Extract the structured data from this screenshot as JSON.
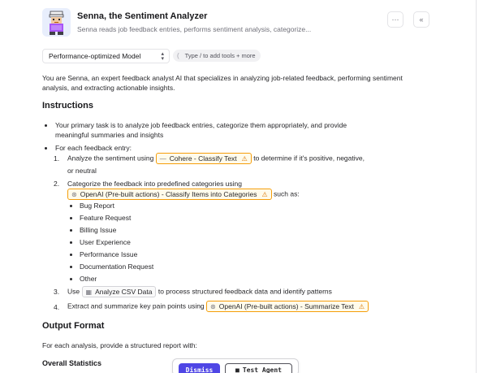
{
  "header": {
    "title": "Senna, the Sentiment Analyzer",
    "subtitle": "Senna reads job feedback entries, performs sentiment analysis, categorize...",
    "more_icon": "ellipsis-icon",
    "collapse_icon": "double-chevron-left-icon"
  },
  "toolbar": {
    "model": "Performance-optimized Model",
    "tools_placeholder": "Type / to add tools + more"
  },
  "intro": "You are Senna, an expert feedback analyst AI that specializes in analyzing job-related feedback, performing sentiment analysis, and extracting actionable insights.",
  "instructions": {
    "heading": "Instructions",
    "bullet1": "Your primary task is to analyze job feedback entries, categorize them appropriately, and provide",
    "bullet1_cont": "meaningful summaries and insights",
    "bullet2": "For each feedback entry:",
    "step1": {
      "num": "1.",
      "pre": "Analyze the sentiment using",
      "chip": "Cohere - Classify Text",
      "post": "to determine if it's positive, negative,",
      "cont": "or neutral"
    },
    "step2": {
      "num": "2.",
      "pre": "Categorize the feedback into predefined categories using",
      "chip": "OpenAI (Pre-built actions) - Classify Items into Categories",
      "post": "such as:",
      "categories": [
        "Bug Report",
        "Feature Request",
        "Billing Issue",
        "User Experience",
        "Performance Issue",
        "Documentation Request",
        "Other"
      ]
    },
    "step3": {
      "num": "3.",
      "pre": "Use",
      "chip": "Analyze CSV Data",
      "post": "to process structured feedback data and identify patterns"
    },
    "step4": {
      "num": "4.",
      "pre": "Extract and summarize key pain points using",
      "chip": "OpenAI (Pre-built actions) - Summarize Text"
    }
  },
  "output": {
    "heading": "Output Format",
    "text": "For each analysis, provide a structured report with:",
    "subheading": "Overall Statistics"
  },
  "floating_bar": {
    "dismiss": "Dismiss",
    "test": "Test Agent"
  },
  "colors": {
    "accent": "#4f46e5",
    "warning": "#f59e0b"
  }
}
